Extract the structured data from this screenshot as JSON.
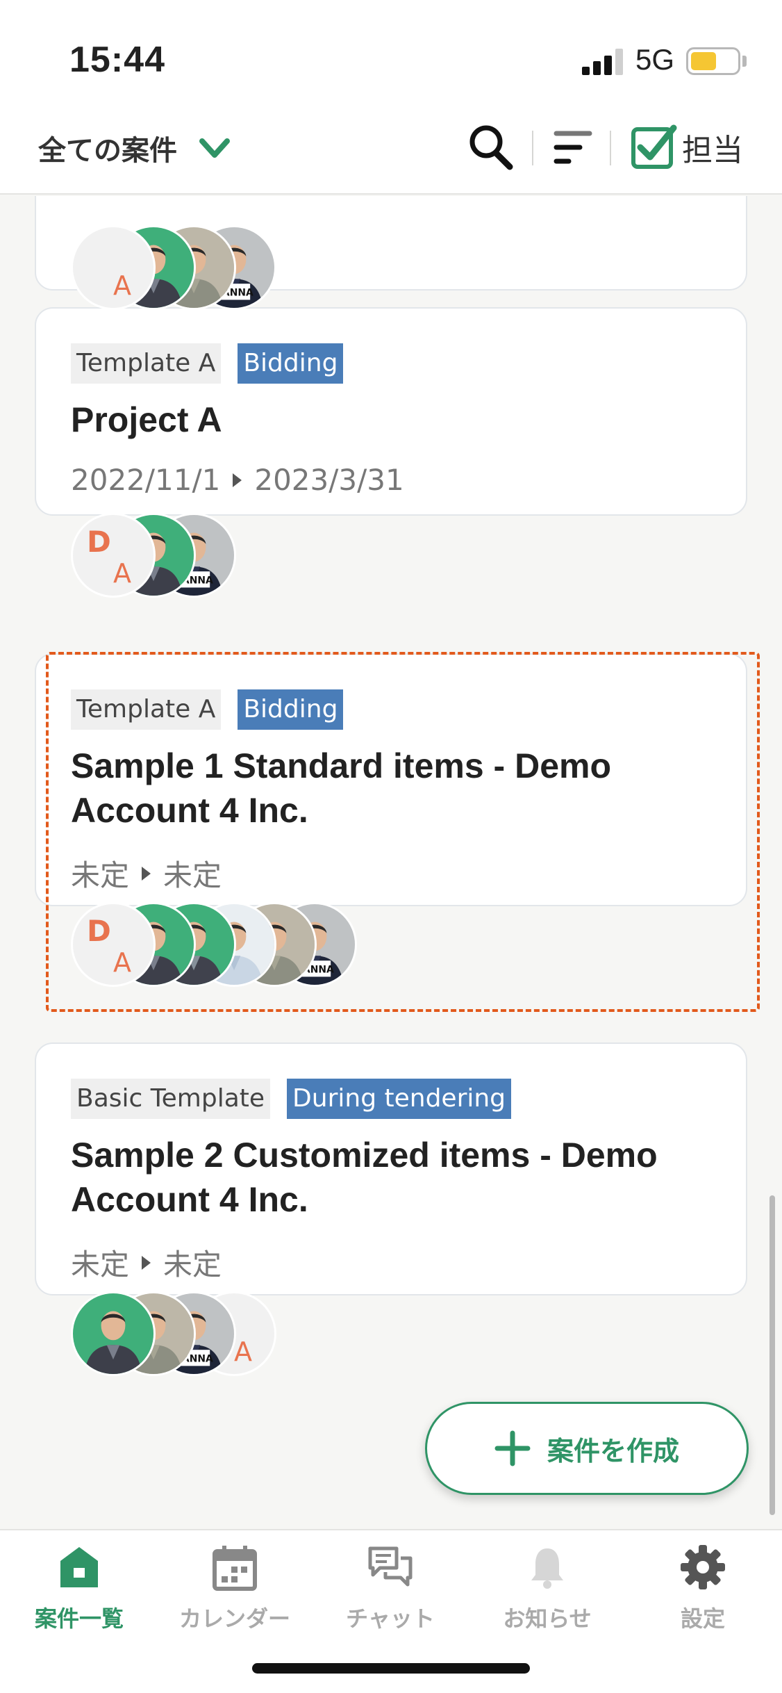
{
  "status_bar": {
    "time": "15:44",
    "network": "5G"
  },
  "header": {
    "filter_label": "全ての案件",
    "assign_label": "担当"
  },
  "projects": [
    {
      "template": "",
      "status": "",
      "title": "",
      "period": {
        "start": "",
        "end": ""
      },
      "avatars": [
        {
          "type": "initials",
          "line1": "",
          "line2": "A"
        },
        {
          "type": "photo",
          "name": "person-green-1"
        },
        {
          "type": "photo",
          "name": "person-beige-1"
        },
        {
          "type": "photo",
          "name": "person-kanna-1"
        }
      ]
    },
    {
      "template": "Template A",
      "status": "Bidding",
      "title": "Project A",
      "period": {
        "start": "2022/11/1",
        "end": "2023/3/31"
      },
      "avatars": [
        {
          "type": "initials",
          "line1": "D",
          "line2": "A"
        },
        {
          "type": "photo",
          "name": "person-green-1"
        },
        {
          "type": "photo",
          "name": "person-kanna-1"
        }
      ]
    },
    {
      "template": "Template A",
      "status": "Bidding",
      "title": "Sample 1 Standard items - Demo Account  4 Inc.",
      "period": {
        "start": "未定",
        "end": "未定"
      },
      "avatars": [
        {
          "type": "initials",
          "line1": "D",
          "line2": "A"
        },
        {
          "type": "photo",
          "name": "person-green-1"
        },
        {
          "type": "photo",
          "name": "person-green-2"
        },
        {
          "type": "photo",
          "name": "person-white-1"
        },
        {
          "type": "photo",
          "name": "person-beige-1"
        },
        {
          "type": "photo",
          "name": "person-kanna-1"
        }
      ]
    },
    {
      "template": "Basic Template",
      "status": "During tendering",
      "title": "Sample 2 Customized items - Demo Account 4 Inc.",
      "period": {
        "start": "未定",
        "end": "未定"
      },
      "avatars": [
        {
          "type": "photo",
          "name": "person-green-1"
        },
        {
          "type": "photo",
          "name": "person-beige-1"
        },
        {
          "type": "photo",
          "name": "person-kanna-1"
        },
        {
          "type": "initials",
          "line1": "D",
          "line2": "A"
        }
      ]
    }
  ],
  "create_button": {
    "label": "案件を作成"
  },
  "bottom_nav": {
    "items": [
      {
        "label": "案件一覧",
        "icon": "home-icon",
        "active": true
      },
      {
        "label": "カレンダー",
        "icon": "calendar-icon",
        "active": false
      },
      {
        "label": "チャット",
        "icon": "chat-icon",
        "active": false
      },
      {
        "label": "お知らせ",
        "icon": "bell-icon",
        "active": false
      },
      {
        "label": "設定",
        "icon": "gear-icon",
        "active": false
      }
    ]
  },
  "colors": {
    "brand_green": "#2f9466",
    "status_chip": "#4a7db8",
    "highlight": "#e25a1c",
    "initials": "#e8734e"
  }
}
